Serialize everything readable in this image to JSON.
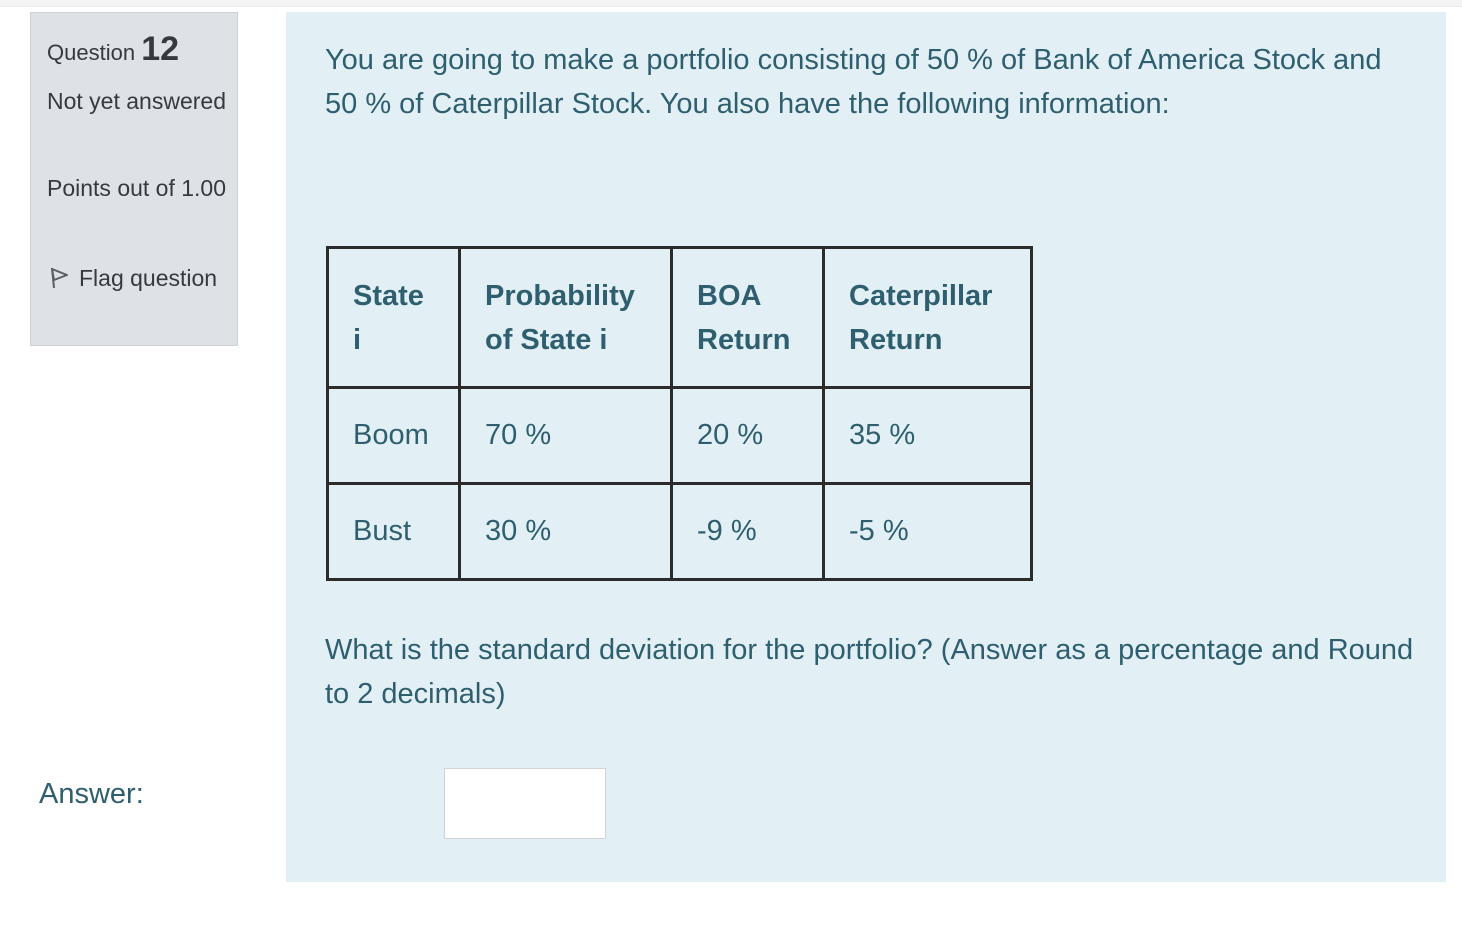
{
  "info": {
    "question_label": "Question",
    "question_number": "12",
    "state": "Not yet answered",
    "grade": "Points out of 1.00",
    "flag_label": "Flag question"
  },
  "question": {
    "intro": "You are going to make a portfolio consisting of 50 % of Bank of America Stock and 50 % of Caterpillar Stock. You also have the following information:",
    "table": {
      "headers": [
        "State i",
        "Probability of State i",
        "BOA Return",
        "Caterpillar Return"
      ],
      "rows": [
        [
          "Boom",
          "70 %",
          "20 %",
          "35 %"
        ],
        [
          "Bust",
          "30 %",
          "-9 %",
          "-5 %"
        ]
      ]
    },
    "prompt": "What is the standard deviation for the portfolio? (Answer as a percentage and Round to 2 decimals)",
    "answer_label": "Answer:",
    "answer_value": ""
  },
  "colors": {
    "text_primary": "#2f5f6e",
    "info_background": "#dee2e6",
    "content_background": "#e2f0f6"
  }
}
